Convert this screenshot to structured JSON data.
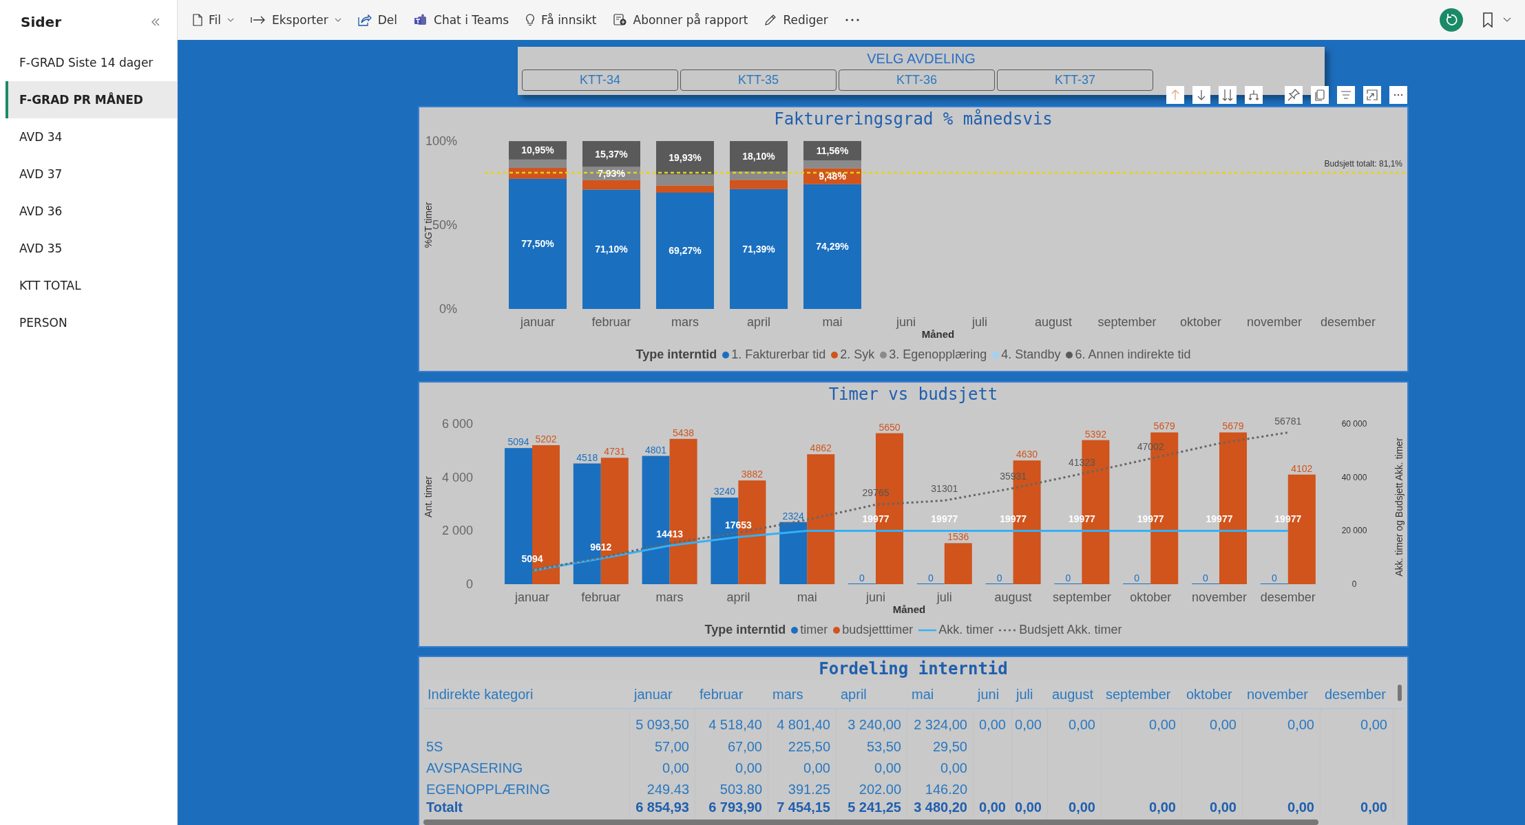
{
  "sidebar": {
    "title": "Sider",
    "items": [
      {
        "label": "F-GRAD Siste 14 dager",
        "selected": false
      },
      {
        "label": "F-GRAD PR MÅNED",
        "selected": true
      },
      {
        "label": "AVD 34",
        "selected": false
      },
      {
        "label": "AVD 37",
        "selected": false
      },
      {
        "label": "AVD 36",
        "selected": false
      },
      {
        "label": "AVD 35",
        "selected": false
      },
      {
        "label": "KTT TOTAL",
        "selected": false
      },
      {
        "label": "PERSON",
        "selected": false
      }
    ]
  },
  "toolbar": [
    {
      "label": "Fil",
      "dropdown": true
    },
    {
      "label": "Eksporter",
      "dropdown": true
    },
    {
      "label": "Del",
      "dropdown": false
    },
    {
      "label": "Chat i Teams",
      "dropdown": false
    },
    {
      "label": "Få innsikt",
      "dropdown": false
    },
    {
      "label": "Abonner på rapport",
      "dropdown": false
    },
    {
      "label": "Rediger",
      "dropdown": false
    }
  ],
  "slicer": {
    "title": "VELG AVDELING",
    "options": [
      {
        "label": "KTT-34",
        "selected": false
      },
      {
        "label": "KTT-35",
        "selected": false
      },
      {
        "label": "KTT-36",
        "selected": false
      },
      {
        "label": "KTT-37",
        "selected": false
      }
    ]
  },
  "chart1": {
    "chart_data": {
      "type": "bar",
      "stacked": true,
      "title": "Faktureringsgrad % månedsvis",
      "xlabel": "Måned",
      "ylabel": "%GT timer",
      "legend_title": "Type interntid",
      "categories": [
        "januar",
        "februar",
        "mars",
        "april",
        "mai",
        "juni",
        "juli",
        "august",
        "september",
        "oktober",
        "november",
        "desember"
      ],
      "ylim": [
        0,
        1
      ],
      "yticks": [
        {
          "value": 0,
          "label": "0%"
        },
        {
          "value": 0.5,
          "label": "50%"
        },
        {
          "value": 1,
          "label": "100%"
        }
      ],
      "series": [
        {
          "name": "1. Fakturerbar tid",
          "color": "#1a6fbf",
          "values": [
            0.775,
            0.711,
            0.6927,
            0.7139,
            0.7429,
            null,
            null,
            null,
            null,
            null,
            null,
            null
          ],
          "value_labels": [
            "77,50%",
            "71,10%",
            "69,27%",
            "71,39%",
            "74,29%",
            null,
            null,
            null,
            null,
            null,
            null,
            null
          ]
        },
        {
          "name": "2. Syk",
          "color": "#d0541c",
          "values": [
            0.065,
            0.056,
            0.043,
            0.055,
            0.0948,
            null,
            null,
            null,
            null,
            null,
            null,
            null
          ],
          "value_labels": [
            null,
            null,
            null,
            null,
            "9,48%",
            null,
            null,
            null,
            null,
            null,
            null,
            null
          ]
        },
        {
          "name": "3. Egenopplæring",
          "color": "#8a8a8a",
          "values": [
            0.05,
            0.0793,
            0.065,
            0.05,
            0.047,
            null,
            null,
            null,
            null,
            null,
            null,
            null
          ],
          "value_labels": [
            null,
            "7,93%",
            null,
            null,
            null,
            null,
            null,
            null,
            null,
            null,
            null,
            null
          ]
        },
        {
          "name": "4. Standby",
          "color": "#9fd3f5",
          "values": [
            null,
            null,
            null,
            null,
            null,
            null,
            null,
            null,
            null,
            null,
            null,
            null
          ]
        },
        {
          "name": "6. Annen indirekte tid",
          "color": "#5a5a5a",
          "values": [
            0.1095,
            0.1537,
            0.1993,
            0.181,
            0.1156,
            null,
            null,
            null,
            null,
            null,
            null,
            null
          ],
          "value_labels": [
            "10,95%",
            "15,37%",
            "19,93%",
            "18,10%",
            "11,56%",
            null,
            null,
            null,
            null,
            null,
            null,
            null
          ]
        }
      ],
      "ref_lines": [
        {
          "axis": "y",
          "value": 0.811,
          "label": "Budsjett totalt: 81,1%"
        }
      ]
    }
  },
  "chart2": {
    "chart_data": {
      "type": "bar",
      "title": "Timer vs budsjett",
      "xlabel": "Måned",
      "ylabel": "Ant. timer",
      "y2label": "Akk. timer og Budsjett Akk. timer",
      "legend_title": "Type interntid",
      "categories": [
        "januar",
        "februar",
        "mars",
        "april",
        "mai",
        "juni",
        "juli",
        "august",
        "september",
        "oktober",
        "november",
        "desember"
      ],
      "ylim": [
        0,
        6000
      ],
      "yticks": [
        {
          "value": 0,
          "label": "0"
        },
        {
          "value": 2000,
          "label": "2 000"
        },
        {
          "value": 4000,
          "label": "4 000"
        },
        {
          "value": 6000,
          "label": "6 000"
        }
      ],
      "y2lim": [
        0,
        60000
      ],
      "y2ticks": [
        {
          "value": 0,
          "label": "0"
        },
        {
          "value": 20000,
          "label": "20 000"
        },
        {
          "value": 40000,
          "label": "40 000"
        },
        {
          "value": 60000,
          "label": "60 000"
        }
      ],
      "series": [
        {
          "name": "timer",
          "type": "bar",
          "color": "#1a6fbf",
          "values": [
            5094,
            4518,
            4801,
            3240,
            2324,
            0,
            0,
            0,
            0,
            0,
            0,
            0
          ],
          "value_labels": [
            "5094",
            "4518",
            "4801",
            "3240",
            "2324",
            "0",
            "0",
            "0",
            "0",
            "0",
            "0",
            "0"
          ]
        },
        {
          "name": "budsjetttimer",
          "type": "bar",
          "color": "#d0541c",
          "values": [
            5202,
            4731,
            5438,
            3882,
            4862,
            5650,
            1536,
            4630,
            5392,
            5679,
            5679,
            4102
          ],
          "value_labels": [
            "5202",
            "4731",
            "5438",
            "3882",
            "4862",
            "5650",
            "1536",
            "4630",
            "5392",
            "5679",
            "5679",
            "4102"
          ]
        },
        {
          "name": "Akk. timer",
          "type": "line",
          "line_style": "solid",
          "axis": "y2",
          "color": "#35b0f5",
          "values": [
            5094,
            9612,
            14413,
            17653,
            19977,
            19977,
            19977,
            19977,
            19977,
            19977,
            19977,
            19977
          ],
          "value_labels": [
            "5094",
            "9612",
            "14413",
            "17653",
            null,
            "19977",
            "19977",
            "19977",
            "19977",
            "19977",
            "19977",
            "19977"
          ]
        },
        {
          "name": "Budsjett Akk. timer",
          "type": "line",
          "line_style": "dotted",
          "axis": "y2",
          "color": "#666666",
          "values": [
            5202,
            9933,
            15371,
            19253,
            24115,
            29765,
            31301,
            35931,
            41323,
            47002,
            52681,
            56781
          ],
          "value_labels": [
            null,
            null,
            null,
            null,
            null,
            "29765",
            "31301",
            "35931",
            "41323",
            "47002",
            null,
            "56781"
          ]
        }
      ]
    }
  },
  "table": {
    "title": "Fordeling interntid",
    "columns": [
      "Indirekte kategori",
      "januar",
      "februar",
      "mars",
      "april",
      "mai",
      "juni",
      "juli",
      "august",
      "september",
      "oktober",
      "november",
      "desember"
    ],
    "rows": [
      {
        "kind": "data",
        "cells": [
          null,
          "5 093,50",
          "4 518,40",
          "4 801,40",
          "3 240,00",
          "2 324,00",
          "0,00",
          "0,00",
          "0,00",
          "0,00",
          "0,00",
          "0,00",
          "0,00"
        ]
      },
      {
        "kind": "data",
        "cells": [
          "5S",
          "57,00",
          "67,00",
          "225,50",
          "53,50",
          "29,50",
          null,
          null,
          null,
          null,
          null,
          null,
          null
        ]
      },
      {
        "kind": "data",
        "cells": [
          "AVSPASERING",
          "0,00",
          "0,00",
          "0,00",
          "0,00",
          "0,00",
          null,
          null,
          null,
          null,
          null,
          null,
          null
        ]
      },
      {
        "kind": "data",
        "cells": [
          "EGENOPPLÆRING",
          "249.43",
          "503.80",
          "391.25",
          "202.00",
          "146.20",
          null,
          null,
          null,
          null,
          null,
          null,
          null
        ]
      },
      {
        "kind": "total",
        "cells": [
          "Totalt",
          "6 854,93",
          "6 793,90",
          "7 454,15",
          "5 241,25",
          "3 480,20",
          "0,00",
          "0,00",
          "0,00",
          "0,00",
          "0,00",
          "0,00",
          "0,00"
        ]
      }
    ]
  }
}
